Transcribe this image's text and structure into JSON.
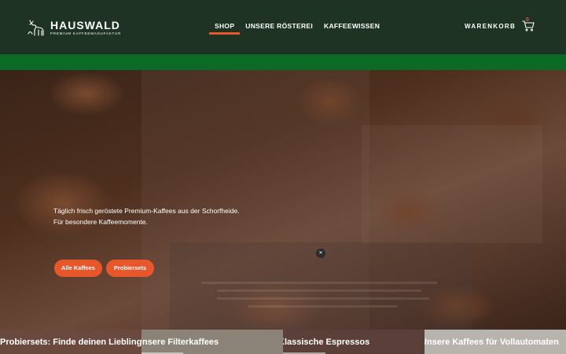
{
  "brand": {
    "name": "HAUSWALD",
    "tagline": "PREMIUM KAFFEEMANUFAKTUR"
  },
  "nav": {
    "items": [
      {
        "label": "SHOP",
        "active": true
      },
      {
        "label": "UNSERE RÖSTEREI",
        "active": false
      },
      {
        "label": "KAFFEEWISSEN",
        "active": false
      }
    ]
  },
  "cart": {
    "label": "WARENKORB",
    "count": "0"
  },
  "hero": {
    "line1": "Täglich frisch geröstete Premium-Kaffees aus der Schorfheide.",
    "line2": "Für besondere Kaffeemomente.",
    "buttons": [
      {
        "label": "Alle Kaffees"
      },
      {
        "label": "Probiersets"
      }
    ]
  },
  "tiles": [
    {
      "title": "Probiersets: Finde deinen Lieblingskaffee"
    },
    {
      "title": "Unsere Filterkaffees"
    },
    {
      "title": "Klassische Espressos"
    },
    {
      "title": "Unsere Kaffees für Vollautomaten"
    }
  ],
  "colors": {
    "header": "#1e3323",
    "band": "#0b6b26",
    "accent": "#e8562c"
  }
}
